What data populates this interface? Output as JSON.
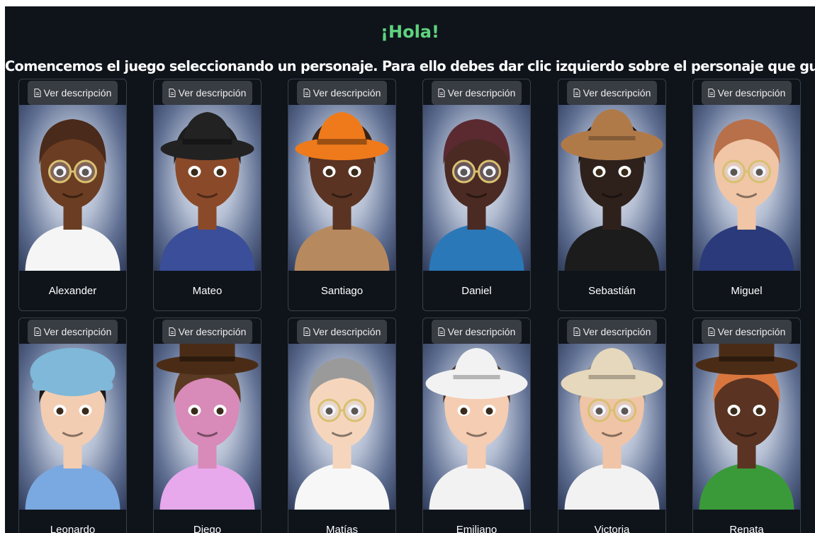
{
  "header": {
    "greeting": "¡Hola!",
    "instruction": "Comencemos el juego seleccionando un personaje. Para ello debes dar clic izquierdo sobre el personaje que gustes"
  },
  "description_button_label": "Ver descripción",
  "characters": [
    {
      "name": "Alexander",
      "skin": "#6b3d22",
      "hair": "#4a2a1a",
      "hat": "none",
      "hat_color": "",
      "shirt": "#f5f5f5",
      "glasses": true
    },
    {
      "name": "Mateo",
      "skin": "#8a4a2a",
      "hair": "#1c1c1c",
      "hat": "fedora",
      "hat_color": "#222222",
      "shirt": "#3a4e9a",
      "glasses": false
    },
    {
      "name": "Santiago",
      "skin": "#5a3322",
      "hair": "#3a2212",
      "hat": "fedora",
      "hat_color": "#ee7a1c",
      "shirt": "#b68a5e",
      "glasses": false
    },
    {
      "name": "Daniel",
      "skin": "#4a2a22",
      "hair": "#5a2a30",
      "hat": "none",
      "hat_color": "",
      "shirt": "#2a78b8",
      "glasses": true
    },
    {
      "name": "Sebastián",
      "skin": "#2e211c",
      "hair": "#1a1412",
      "hat": "wide",
      "hat_color": "#b07a48",
      "shirt": "#1c1c1c",
      "glasses": false
    },
    {
      "name": "Miguel",
      "skin": "#f0c6a6",
      "hair": "#b8704a",
      "hat": "none",
      "hat_color": "",
      "shirt": "#2a3a7a",
      "glasses": true
    },
    {
      "name": "Leonardo",
      "skin": "#f3cdb2",
      "hair": "#1a1a1a",
      "hat": "cap",
      "hat_color": "#7fb8d8",
      "shirt": "#7aa8e0",
      "glasses": false
    },
    {
      "name": "Diego",
      "skin": "#d88ab8",
      "hair": "#5a3a22",
      "hat": "top",
      "hat_color": "#4a2c16",
      "shirt": "#e7a8ec",
      "glasses": false
    },
    {
      "name": "Matías",
      "skin": "#f5d6bd",
      "hair": "#9a9a9a",
      "hat": "none",
      "hat_color": "",
      "shirt": "#f7f7f7",
      "glasses": true
    },
    {
      "name": "Emiliano",
      "skin": "#f5cdb2",
      "hair": "#4a3428",
      "hat": "wide",
      "hat_color": "#f2f2f2",
      "shirt": "#f2f2f2",
      "glasses": false
    },
    {
      "name": "Victoria",
      "skin": "#f0c4a6",
      "hair": "#8a8a8a",
      "hat": "wide",
      "hat_color": "#e6d8bc",
      "shirt": "#f2f2f2",
      "glasses": true
    },
    {
      "name": "Renata",
      "skin": "#5a3322",
      "hair": "#d8763e",
      "hat": "top",
      "hat_color": "#4a2c16",
      "shirt": "#3a9a3a",
      "glasses": false
    }
  ]
}
